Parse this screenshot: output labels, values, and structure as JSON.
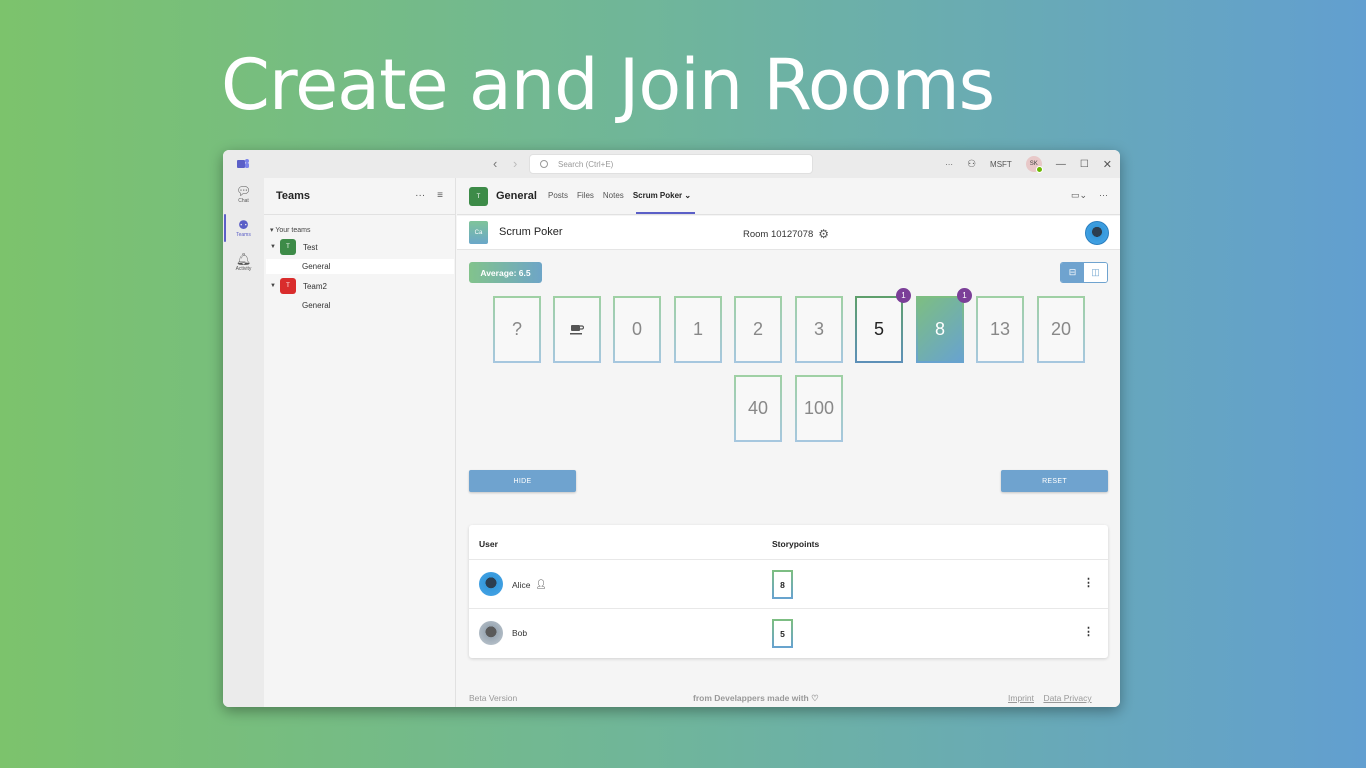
{
  "headline": "Create and Join Rooms",
  "titlebar": {
    "search_placeholder": "Search (Ctrl+E)",
    "more": "···",
    "org": "MSFT",
    "user_initials": "SK"
  },
  "rail": {
    "items": [
      {
        "label": "Chat",
        "icon": "chat-icon"
      },
      {
        "label": "Teams",
        "icon": "teams-icon"
      },
      {
        "label": "Activity",
        "icon": "bell-icon"
      }
    ]
  },
  "teams_panel": {
    "title": "Teams",
    "more": "···",
    "section": "Your teams",
    "teams": [
      {
        "name": "Test",
        "initial": "T",
        "color": "#3d8b48",
        "channel": "General"
      },
      {
        "name": "Team2",
        "initial": "T",
        "color": "#d92c2c",
        "channel": "General"
      }
    ]
  },
  "channel": {
    "initial": "T",
    "name": "General",
    "tabs": [
      "Posts",
      "Files",
      "Notes",
      "Scrum Poker"
    ],
    "more": "···"
  },
  "app": {
    "icon_text": "Ca",
    "name": "Scrum Poker",
    "room": "Room 10127078",
    "average": "Average: 6.5",
    "cards": [
      {
        "label": "?",
        "state": "normal"
      },
      {
        "label": "",
        "state": "normal",
        "icon": "coffee-icon"
      },
      {
        "label": "0",
        "state": "normal"
      },
      {
        "label": "1",
        "state": "normal"
      },
      {
        "label": "2",
        "state": "normal"
      },
      {
        "label": "3",
        "state": "normal"
      },
      {
        "label": "5",
        "state": "selected",
        "badge": "1"
      },
      {
        "label": "8",
        "state": "chosen",
        "badge": "1"
      },
      {
        "label": "13",
        "state": "normal"
      },
      {
        "label": "20",
        "state": "normal"
      },
      {
        "label": "40",
        "state": "normal"
      },
      {
        "label": "100",
        "state": "normal"
      }
    ],
    "hide_label": "HIDE",
    "reset_label": "RESET",
    "table": {
      "col_user": "User",
      "col_points": "Storypoints",
      "rows": [
        {
          "name": "Alice",
          "points": "8",
          "owner": true
        },
        {
          "name": "Bob",
          "points": "5",
          "owner": false
        }
      ]
    },
    "footer": {
      "beta": "Beta Version",
      "credit": "from Develappers made with",
      "imprint": "Imprint",
      "privacy": "Data Privacy"
    }
  },
  "colors": {
    "accent": "#6fa3cf",
    "badge": "#7b3f98",
    "teams_purple": "#5b5fc7"
  }
}
